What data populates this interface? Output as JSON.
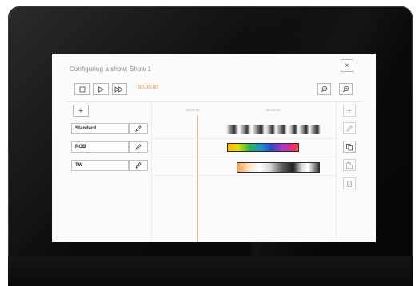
{
  "dialog": {
    "title": "Configuring a show: Show 1",
    "close_label": "×",
    "time": "00:00:00",
    "add_label": "+"
  },
  "transport": {
    "stop_icon": "stop-icon",
    "play_icon": "play-icon",
    "fast_forward_icon": "fast-forward-icon"
  },
  "timeline": {
    "ticks": [
      "00:00:00",
      "10:00:00"
    ]
  },
  "tracks": [
    {
      "label": "Standard",
      "edit_icon": "pencil-icon"
    },
    {
      "label": "RGB",
      "edit_icon": "pencil-icon"
    },
    {
      "label": "TW",
      "edit_icon": "pencil-icon"
    }
  ],
  "side_tools": {
    "add_label": "+",
    "icons": [
      "add-icon",
      "pencil-icon",
      "copy-icon",
      "paste-icon",
      "delete-icon"
    ]
  },
  "colors": {
    "accent": "#e3782b",
    "playhead": "#f0b48a"
  }
}
